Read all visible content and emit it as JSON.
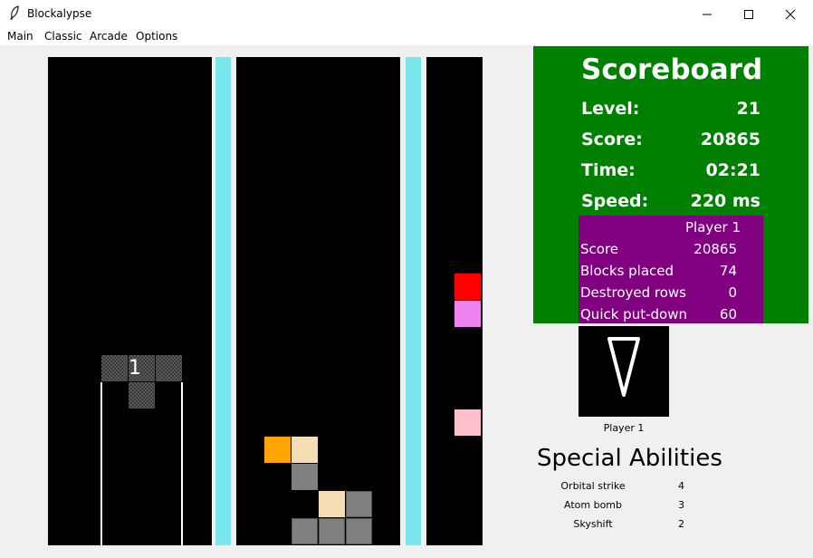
{
  "window": {
    "title": "Blockalypse",
    "icon": "feather-icon",
    "minimize_glyph": "—",
    "maximize_glyph": "☐",
    "close_glyph": "✕"
  },
  "menu": [
    "Main",
    "Classic",
    "Arcade",
    "Options"
  ],
  "game": {
    "active_piece_label": "1",
    "colors": {
      "board": "#000000",
      "divider": "#7ae6ee",
      "orange": "#ffa500",
      "wheat": "#f5deb3",
      "gray": "#808080",
      "red": "#ff0000",
      "violet": "#ee82ee",
      "pink": "#ffc0cb"
    }
  },
  "scoreboard": {
    "title": "Scoreboard",
    "rows": [
      {
        "label": "Level:",
        "value": "21"
      },
      {
        "label": "Score:",
        "value": "20865"
      },
      {
        "label": "Time:",
        "value": "02:21"
      },
      {
        "label": "Speed:",
        "value": "220 ms"
      }
    ],
    "background": "#008000"
  },
  "player_stats": {
    "header": "Player 1",
    "rows": [
      {
        "label": "Score",
        "value": "20865"
      },
      {
        "label": "Blocks placed",
        "value": "74"
      },
      {
        "label": "Destroyed rows",
        "value": "0"
      },
      {
        "label": "Quick put-down",
        "value": "60"
      }
    ],
    "background": "#800080"
  },
  "next_piece": {
    "icon": "triangle-piece-icon",
    "caption": "Player 1"
  },
  "special_abilities": {
    "title": "Special Abilities",
    "items": [
      {
        "name": "Orbital strike",
        "count": "4"
      },
      {
        "name": "Atom bomb",
        "count": "3"
      },
      {
        "name": "Skyshift",
        "count": "2"
      }
    ]
  }
}
